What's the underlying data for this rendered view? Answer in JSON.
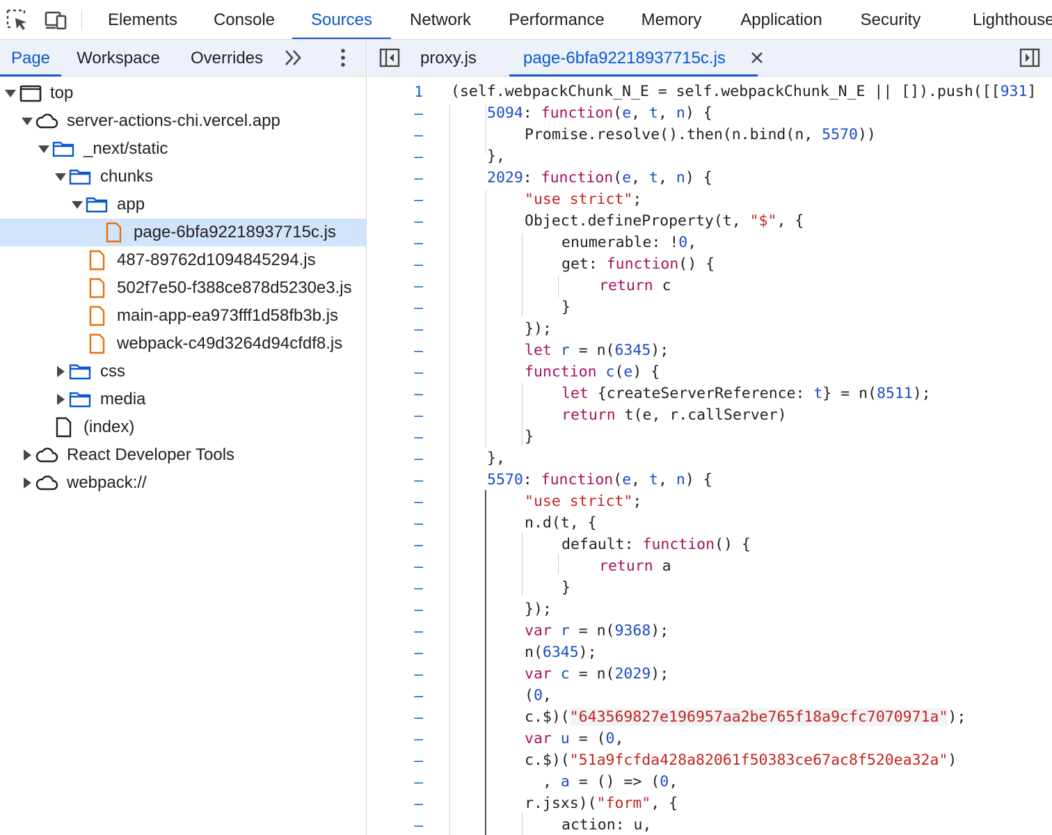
{
  "toolbar": {
    "tabs": [
      "Elements",
      "Console",
      "Sources",
      "Network",
      "Performance",
      "Memory",
      "Application",
      "Security",
      "Lighthouse"
    ],
    "active_tab": "Sources"
  },
  "navigator": {
    "tabs": [
      "Page",
      "Workspace",
      "Overrides"
    ],
    "active_tab": "Page",
    "tree": [
      {
        "label": "top",
        "icon": "frame-icon",
        "expanded": true
      },
      {
        "label": "server-actions-chi.vercel.app",
        "icon": "cloud-icon",
        "expanded": true
      },
      {
        "label": "_next/static",
        "icon": "folder-icon",
        "expanded": true
      },
      {
        "label": "chunks",
        "icon": "folder-icon",
        "expanded": true
      },
      {
        "label": "app",
        "icon": "folder-icon",
        "expanded": true
      },
      {
        "label": "page-6bfa92218937715c.js",
        "icon": "file-js-icon",
        "selected": true
      },
      {
        "label": "487-89762d1094845294.js",
        "icon": "file-js-icon"
      },
      {
        "label": "502f7e50-f388ce878d5230e3.js",
        "icon": "file-js-icon"
      },
      {
        "label": "main-app-ea973fff1d58fb3b.js",
        "icon": "file-js-icon"
      },
      {
        "label": "webpack-c49d3264d94cfdf8.js",
        "icon": "file-js-icon"
      },
      {
        "label": "css",
        "icon": "folder-icon",
        "expanded": false
      },
      {
        "label": "media",
        "icon": "folder-icon",
        "expanded": false
      },
      {
        "label": "(index)",
        "icon": "file-icon"
      },
      {
        "label": "React Developer Tools",
        "icon": "cloud-icon",
        "expanded": false
      },
      {
        "label": "webpack://",
        "icon": "cloud-icon",
        "expanded": false
      }
    ]
  },
  "editor": {
    "tabs": [
      "proxy.js",
      "page-6bfa92218937715c.js"
    ],
    "active_tab": "page-6bfa92218937715c.js",
    "first_line_number": "1",
    "gutter_mark": "–",
    "lines": [
      "(self.webpackChunk_N_E = self.webpackChunk_N_E || []).push([[931]",
      "5094: function(e, t, n) {",
      "Promise.resolve().then(n.bind(n, 5570))",
      "},",
      "2029: function(e, t, n) {",
      "\"use strict\";",
      "Object.defineProperty(t, \"$\", {",
      "enumerable: !0,",
      "get: function() {",
      "return c",
      "}",
      "});",
      "let r = n(6345);",
      "function c(e) {",
      "let {createServerReference: t} = n(8511);",
      "return t(e, r.callServer)",
      "}",
      "},",
      "5570: function(e, t, n) {",
      "\"use strict\";",
      "n.d(t, {",
      "default: function() {",
      "return a",
      "}",
      "});",
      "var r = n(9368);",
      "n(6345);",
      "var c = n(2029);",
      "(0,",
      "c.$)(\"643569827e196957aa2be765f18a9cfc7070971a\");",
      "var u = (0,",
      "c.$)(\"51a9fcfda428a82061f50383ce67ac8f520ea32a\")",
      ", a = () => (0,",
      "r.jsxs)(\"form\", {",
      "action: u,"
    ]
  }
}
